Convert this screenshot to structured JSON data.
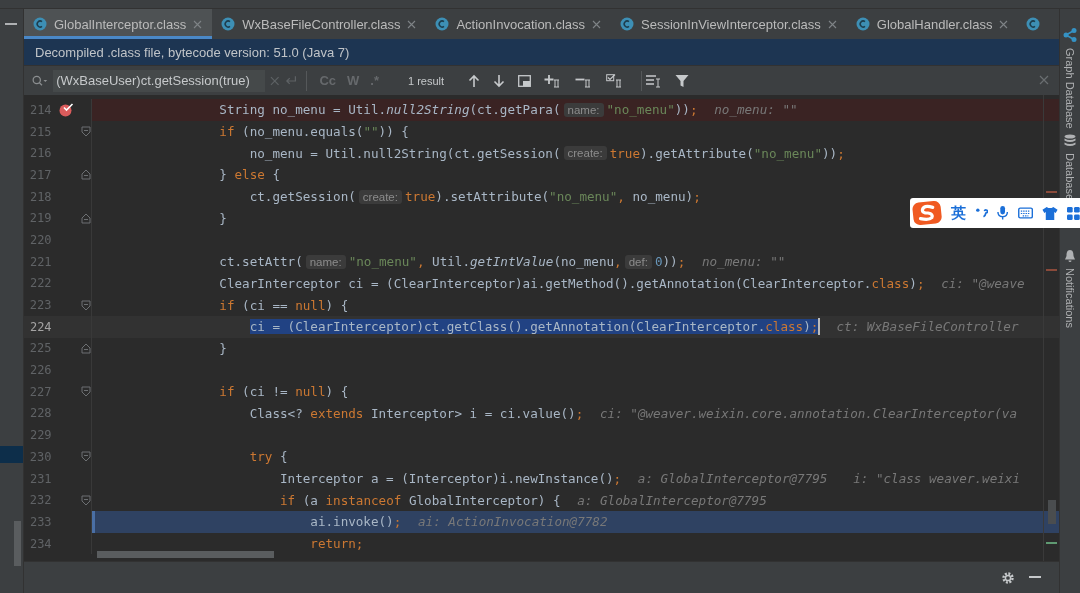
{
  "tabs": [
    {
      "label": "GlobalInterceptor.class",
      "selected": true
    },
    {
      "label": "WxBaseFileController.class",
      "selected": false
    },
    {
      "label": "ActionInvocation.class",
      "selected": false
    },
    {
      "label": "SessionInViewInterceptor.class",
      "selected": false
    },
    {
      "label": "GlobalHandler.class",
      "selected": false
    }
  ],
  "banner": "Decompiled .class file, bytecode version: 51.0 (Java 7)",
  "find": {
    "query": "(WxBaseUser)ct.getSession(true)",
    "toggles": [
      {
        "label": "Cc",
        "disabled": true
      },
      {
        "label": "W",
        "disabled": true
      },
      {
        "label": ".*",
        "disabled": true
      }
    ],
    "result": "1 result"
  },
  "code": [
    {
      "number": "214",
      "breakpoint": true,
      "execution_point": false,
      "caret": false,
      "fold_open": false,
      "fold_close": false,
      "segments": [
        {
          "code": "                String no_menu = Util.*null2String*(ct.getPara("
        },
        {
          "hint": "name:"
        },
        {
          "code": "\"no_menu\"))**;**"
        },
        {
          "value": "no_menu: \"\""
        }
      ]
    },
    {
      "number": "215",
      "breakpoint": false,
      "execution_point": false,
      "caret": false,
      "fold_open": true,
      "fold_close": false,
      "segments": [
        {
          "code": "                **if** (no_menu.equals(\"\")) {"
        }
      ]
    },
    {
      "number": "216",
      "breakpoint": false,
      "execution_point": false,
      "caret": false,
      "fold_open": false,
      "fold_close": false,
      "segments": [
        {
          "code": "                    no_menu = Util.null2String(ct.getSession("
        },
        {
          "hint": "create:"
        },
        {
          "code": "**true**).getAttribute(\"no_menu\"))**;**"
        }
      ]
    },
    {
      "number": "217",
      "breakpoint": false,
      "execution_point": false,
      "caret": false,
      "fold_open": false,
      "fold_close": true,
      "segments": [
        {
          "code": "                } **else** {"
        }
      ]
    },
    {
      "number": "218",
      "breakpoint": false,
      "execution_point": false,
      "caret": false,
      "fold_open": false,
      "fold_close": false,
      "segments": [
        {
          "code": "                    ct.getSession("
        },
        {
          "hint": "create:"
        },
        {
          "code": "**true**).setAttribute(\"no_menu\"**,** no_menu)**;**"
        }
      ]
    },
    {
      "number": "219",
      "breakpoint": false,
      "execution_point": false,
      "caret": false,
      "fold_open": false,
      "fold_close": true,
      "segments": [
        {
          "code": "                }"
        }
      ]
    },
    {
      "number": "220",
      "breakpoint": false,
      "execution_point": false,
      "caret": false,
      "fold_open": false,
      "fold_close": false
    },
    {
      "number": "221",
      "breakpoint": false,
      "execution_point": false,
      "caret": false,
      "fold_open": false,
      "fold_close": false,
      "segments": [
        {
          "code": "                ct.setAttr("
        },
        {
          "hint": "name:"
        },
        {
          "code": "\"no_menu\"**,** Util.*getIntValue*(no_menu**,**"
        },
        {
          "hint": "def:"
        },
        {
          "code": "0))**;**"
        },
        {
          "value": "no_menu: \"\""
        }
      ]
    },
    {
      "number": "222",
      "breakpoint": false,
      "execution_point": false,
      "caret": false,
      "fold_open": false,
      "fold_close": false,
      "segments": [
        {
          "code": "                ClearInterceptor ci = (ClearInterceptor)ai.getMethod().getAnnotation(ClearInterceptor.**class**)**;**"
        },
        {
          "value": "ci: \"@weave"
        }
      ]
    },
    {
      "number": "223",
      "breakpoint": false,
      "execution_point": false,
      "caret": false,
      "fold_open": true,
      "fold_close": false,
      "segments": [
        {
          "code": "                **if** (ci == **null**) {"
        }
      ]
    },
    {
      "number": "224",
      "breakpoint": false,
      "execution_point": false,
      "caret": true,
      "fold_open": false,
      "fold_close": false,
      "segments": [
        {
          "selection": "                    ci = (ClearInterceptor)ct.getClass().getAnnotation(ClearInterceptor.**class**)**;**"
        },
        {
          "value": "ct: WxBaseFileController"
        }
      ]
    },
    {
      "number": "225",
      "breakpoint": false,
      "execution_point": false,
      "caret": false,
      "fold_open": false,
      "fold_close": true,
      "segments": [
        {
          "code": "                }"
        }
      ]
    },
    {
      "number": "226",
      "breakpoint": false,
      "execution_point": false,
      "caret": false,
      "fold_open": false,
      "fold_close": false
    },
    {
      "number": "227",
      "breakpoint": false,
      "execution_point": false,
      "caret": false,
      "fold_open": true,
      "fold_close": false,
      "segments": [
        {
          "code": "                **if** (ci != **null**) {"
        }
      ]
    },
    {
      "number": "228",
      "breakpoint": false,
      "execution_point": false,
      "caret": false,
      "fold_open": false,
      "fold_close": false,
      "segments": [
        {
          "code": "                    Class<? **extends** Interceptor> i = ci.value()**;**"
        },
        {
          "value": "ci: \"@weaver.weixin.core.annotation.ClearInterceptor(va"
        }
      ]
    },
    {
      "number": "229",
      "breakpoint": false,
      "execution_point": false,
      "caret": false,
      "fold_open": false,
      "fold_close": false
    },
    {
      "number": "230",
      "breakpoint": false,
      "execution_point": false,
      "caret": false,
      "fold_open": true,
      "fold_close": false,
      "segments": [
        {
          "code": "                    **try** {"
        }
      ]
    },
    {
      "number": "231",
      "breakpoint": false,
      "execution_point": false,
      "caret": false,
      "fold_open": false,
      "fold_close": false,
      "segments": [
        {
          "code": "                        Interceptor a = (Interceptor)i.newInstance()**;**"
        },
        {
          "value": "a: GlobalInterceptor@7795"
        },
        {
          "value": "i: \"class weaver.weixi"
        }
      ]
    },
    {
      "number": "232",
      "breakpoint": false,
      "execution_point": false,
      "caret": false,
      "fold_open": true,
      "fold_close": false,
      "segments": [
        {
          "code": "                        **if** (a **instanceof** GlobalInterceptor) {"
        },
        {
          "value": "a: GlobalInterceptor@7795"
        }
      ]
    },
    {
      "number": "233",
      "breakpoint": false,
      "execution_point": true,
      "caret": false,
      "fold_open": false,
      "fold_close": false,
      "segments": [
        {
          "code": "                            ai.invoke()**;**"
        },
        {
          "value": "ai: ActionInvocation@7782"
        }
      ]
    },
    {
      "number": "234",
      "breakpoint": false,
      "execution_point": false,
      "caret": false,
      "fold_open": false,
      "fold_close": false,
      "segments": [
        {
          "code": "                            **return;**"
        }
      ]
    }
  ],
  "side_panel": [
    {
      "label": "Graph Database"
    },
    {
      "label": "Database"
    },
    {
      "label": "Notifications"
    }
  ],
  "ime": {
    "mode": "英"
  }
}
